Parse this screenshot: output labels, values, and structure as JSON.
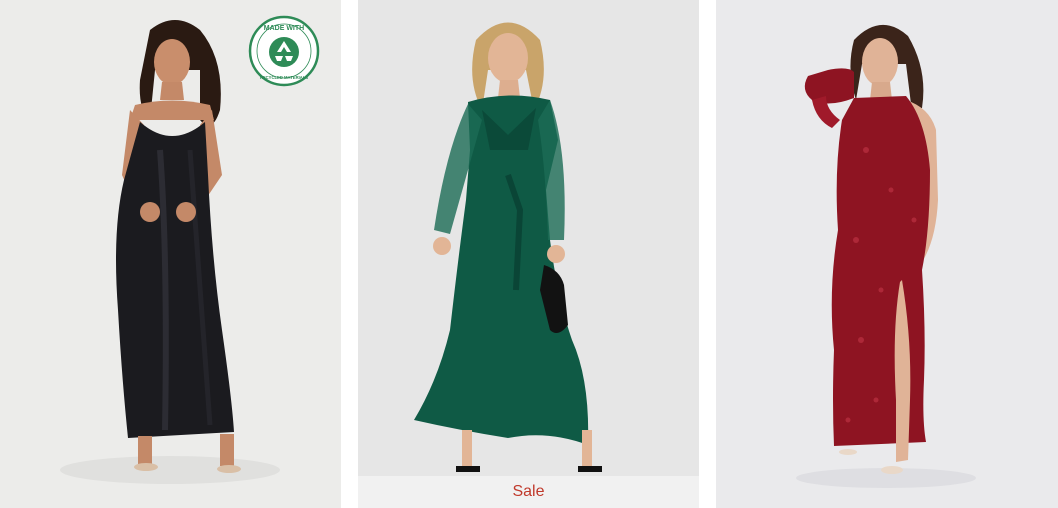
{
  "products": [
    {
      "id": "black-satin-maxi",
      "badge": {
        "top_text": "MADE WITH",
        "bottom_text": "RECYCLED MATERIALS",
        "icon": "recycle-icon",
        "color": "#2e8b57"
      },
      "colors": {
        "background": "#ececea",
        "dress": "#1b1b1f"
      }
    },
    {
      "id": "green-wrap-maxi",
      "label": "Sale",
      "colors": {
        "background": "#e6e6e6",
        "dress": "#0f5a45",
        "label": "#c0392b"
      }
    },
    {
      "id": "red-sequin-one-shoulder",
      "colors": {
        "background": "#eaeaec",
        "dress": "#8e1422"
      }
    }
  ]
}
